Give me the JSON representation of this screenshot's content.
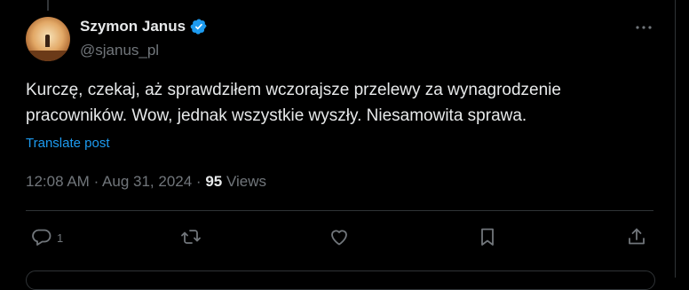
{
  "author": {
    "name": "Szymon Janus",
    "handle": "@sjanus_pl",
    "verified": true
  },
  "post": {
    "text_lines": [
      "Kurczę, czekaj, aż sprawdziłem wczorajsze przelewy za wynagrodzenie",
      "pracowników. Wow, jednak wszystkie wyszły. Niesamowita sprawa."
    ],
    "translate_label": "Translate post"
  },
  "meta": {
    "time": "12:08 AM",
    "date": "Aug 31, 2024",
    "separator": "·",
    "views_count": "95",
    "views_label": "Views"
  },
  "actions": {
    "reply_count": "1"
  },
  "colors": {
    "background": "#000000",
    "text": "#e7e9ea",
    "muted": "#71767b",
    "accent": "#1d9bf0",
    "border": "#2f3336"
  },
  "icons": [
    "ellipsis-icon",
    "verified-badge-icon",
    "reply-icon",
    "repost-icon",
    "like-icon",
    "bookmark-icon",
    "share-icon"
  ]
}
